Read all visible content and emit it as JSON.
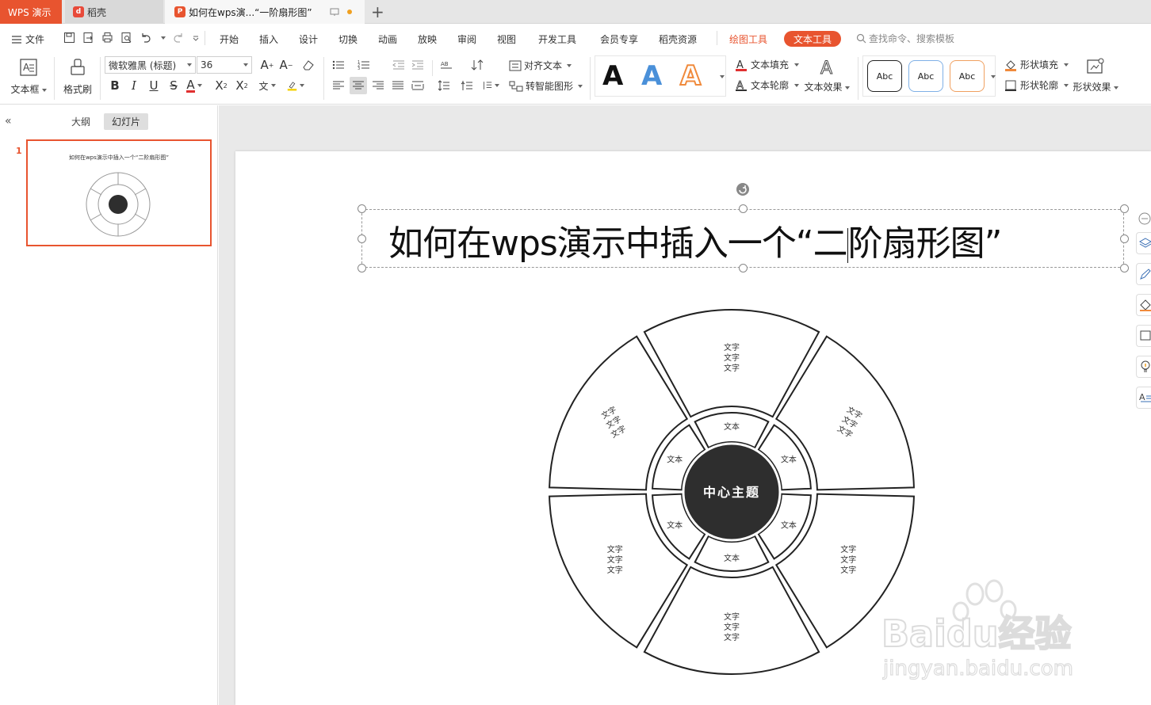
{
  "tabs": {
    "app": "WPS 演示",
    "daoke": "稻壳",
    "doc": "如何在wps演...“一阶扇形图”",
    "add": "+"
  },
  "menu": {
    "file": "文件",
    "items": [
      "开始",
      "插入",
      "设计",
      "切换",
      "动画",
      "放映",
      "审阅",
      "视图",
      "开发工具",
      "会员专享",
      "稻壳资源"
    ],
    "draw_tool": "绘图工具",
    "text_tool": "文本工具",
    "search_placeholder": "查找命令、搜索模板"
  },
  "ribbon": {
    "textbox": "文本框",
    "format_painter": "格式刷",
    "font_name": "微软雅黑 (标题)",
    "font_size": "36",
    "align_text": "对齐文本",
    "smart_shape": "转智能图形",
    "text_fill": "文本填充",
    "text_outline": "文本轮廓",
    "text_effect": "文本效果",
    "shape_fill": "形状填充",
    "shape_outline": "形状轮廓",
    "shape_effect": "形状效果",
    "art_letter": "A",
    "style_sample": "Abc",
    "art_colors": [
      "#111111",
      "#4a90d9",
      "#f08a3c"
    ]
  },
  "left": {
    "outline_tab": "大纲",
    "slides_tab": "幻灯片",
    "slide_number": "1",
    "thumb_title": "如何在wps演示中插入一个“二阶扇形图”"
  },
  "slide": {
    "title_before_cursor": "如何在wps演示中插入一个“二",
    "title_after_cursor": "阶扇形图”",
    "center_label": "中心主题",
    "inner_label": "文本",
    "outer_label_line": "文字"
  },
  "watermark": {
    "brand": "Baidu经验",
    "url": "jingyan.baidu.com"
  },
  "colors": {
    "accent": "#e8542f",
    "center_fill": "#2e2e2e"
  }
}
